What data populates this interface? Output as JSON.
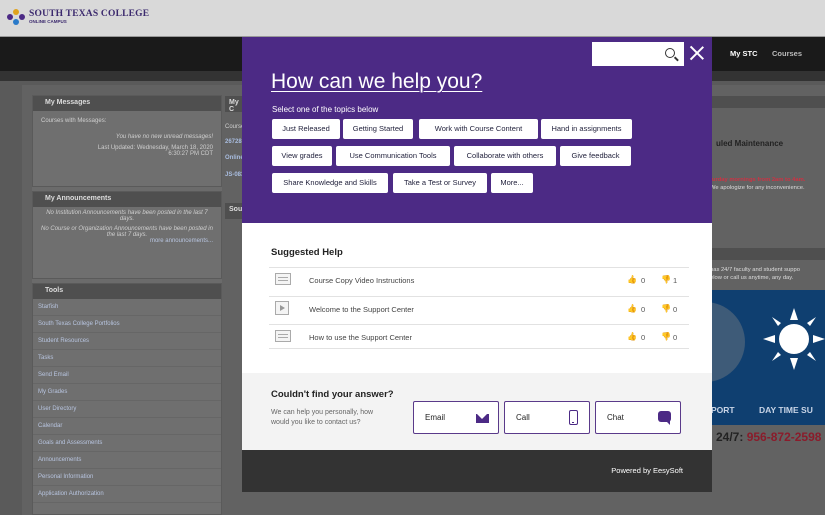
{
  "app": {
    "logo_title": "SOUTH TEXAS COLLEGE",
    "logo_subtitle": "ONLINE CAMPUS",
    "nav": {
      "mystc": "My STC",
      "courses": "Courses"
    }
  },
  "background": {
    "messages": {
      "header": "My Messages",
      "courses_with": "Courses with Messages:",
      "none": "You have no new unread messages!",
      "updated": "Last Updated: Wednesday, March 18, 2020",
      "time": "6:30:27 PM CDT"
    },
    "announcements": {
      "header": "My Announcements",
      "inst": "No Institution Announcements have been posted in the last 7 days.",
      "course": "No Course or Organization Announcements have been posted in the last 7 days.",
      "more": "more announcements..."
    },
    "tools": {
      "header": "Tools",
      "items": [
        "Starfish",
        "South Texas College Portfolios",
        "Student Resources",
        "Tasks",
        "Send Email",
        "My Grades",
        "User Directory",
        "Calendar",
        "Goals and Assessments",
        "Announcements",
        "Personal Information",
        "Application Authorization"
      ]
    },
    "my_courses": {
      "header": "My C",
      "course_label": "Course",
      "item1": "26728.2",
      "item2": "Online",
      "item3": "JS-083:"
    },
    "south_header": "Sout",
    "maintenance": "uled Maintenance",
    "maint_note_red": "turday mornings from 2am to 4am.",
    "maint_note": "We apologize for any inconvenience.",
    "support_text_1": "has 24/7 faculty and student suppo",
    "support_text_2": "elow or call us anytime, any day.",
    "banner_port": "PORT",
    "banner_day": "DAY TIME SU",
    "hotline_prefix": "24/7:",
    "hotline_number": "956-872-2598"
  },
  "modal": {
    "title": "How can we help you?",
    "select_text": "Select one of the topics below",
    "search_placeholder": "",
    "topics": [
      "Just Released",
      "Getting Started",
      "Work with Course Content",
      "Hand in assignments",
      "View grades",
      "Use Communication Tools",
      "Collaborate with others",
      "Give feedback",
      "Share Knowledge and Skills",
      "Take a Test or Survey",
      "More..."
    ],
    "suggested_heading": "Suggested Help",
    "suggested": [
      {
        "title": "Course Copy Video Instructions",
        "up": "0",
        "down": "1",
        "icon": "document-icon"
      },
      {
        "title": "Welcome to the Support Center",
        "up": "0",
        "down": "0",
        "icon": "video-icon"
      },
      {
        "title": "How to use the Support Center",
        "up": "0",
        "down": "0",
        "icon": "document-icon"
      }
    ],
    "cant_find": "Couldn't find your answer?",
    "help_text": "We can help you personally, how would you like to contact us?",
    "contact": {
      "email": "Email",
      "call": "Call",
      "chat": "Chat"
    },
    "powered_by": "Powered by EesySoft"
  },
  "colors": {
    "modal_purple": "#4c2a85",
    "footer": "#333333",
    "overlay": "#5a5a5a"
  }
}
